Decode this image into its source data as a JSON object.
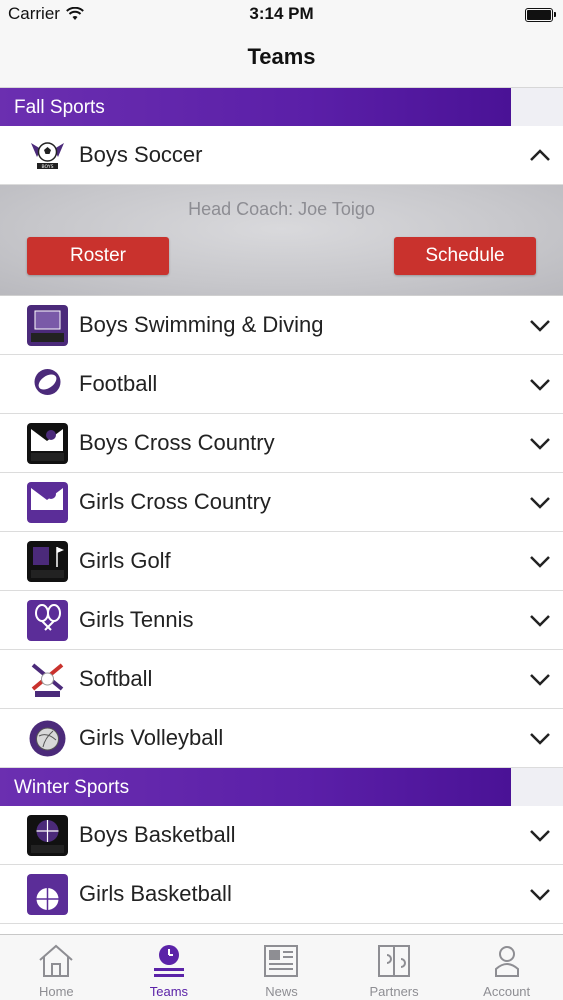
{
  "status": {
    "carrier": "Carrier",
    "time": "3:14 PM"
  },
  "nav": {
    "title": "Teams"
  },
  "sections": [
    {
      "title": "Fall Sports"
    },
    {
      "title": "Winter Sports"
    }
  ],
  "expanded": {
    "team": "Boys Soccer",
    "coach": "Head Coach: Joe Toigo",
    "roster_label": "Roster",
    "schedule_label": "Schedule"
  },
  "fall_rows": [
    {
      "label": "Boys Swimming & Diving"
    },
    {
      "label": "Football"
    },
    {
      "label": "Boys Cross Country"
    },
    {
      "label": "Girls Cross Country"
    },
    {
      "label": "Girls Golf"
    },
    {
      "label": "Girls Tennis"
    },
    {
      "label": "Softball"
    },
    {
      "label": "Girls Volleyball"
    }
  ],
  "winter_rows": [
    {
      "label": "Boys Basketball"
    },
    {
      "label": "Girls Basketball"
    }
  ],
  "tabs": [
    {
      "label": "Home"
    },
    {
      "label": "Teams"
    },
    {
      "label": "News"
    },
    {
      "label": "Partners"
    },
    {
      "label": "Account"
    }
  ],
  "colors": {
    "accent": "#5b23a8",
    "button": "#c9322d"
  }
}
